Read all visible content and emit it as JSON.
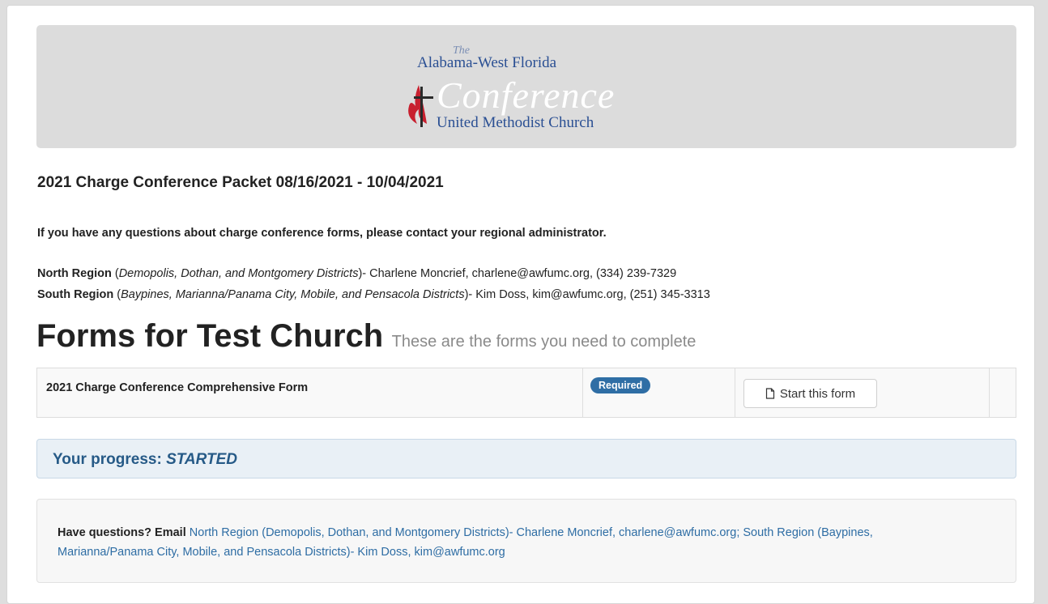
{
  "logo": {
    "the": "The",
    "line1": "Alabama-West Florida",
    "line2": "Conference",
    "line3": "United Methodist Church",
    "colors": {
      "blue": "#2a4f93",
      "red": "#c8202f"
    },
    "icon": "cross-and-flame-icon"
  },
  "packet": {
    "title": "2021 Charge Conference Packet 08/16/2021 - 10/04/2021"
  },
  "notice": "If you have any questions about charge conference forms, please contact your regional administrator.",
  "regions": [
    {
      "name": "North Region",
      "open": " (",
      "districts": "Demopolis, Dothan, and Montgomery Districts",
      "contact": ")- Charlene Moncrief, charlene@awfumc.org, (334) 239-7329"
    },
    {
      "name": "South Region",
      "open": " (",
      "districts": "Baypines, Marianna/Panama City, Mobile, and Pensacola Districts",
      "contact": ")- Kim Doss, kim@awfumc.org, (251) 345-3313"
    }
  ],
  "forms": {
    "heading": "Forms for Test Church",
    "subheading": "These are the forms you need to complete",
    "rows": [
      {
        "name": "2021 Charge Conference Comprehensive Form",
        "badge": "Required",
        "action": "Start this form",
        "action_icon": "document-icon"
      }
    ]
  },
  "progress": {
    "label": "Your progress: ",
    "status": "STARTED"
  },
  "questions": {
    "lead": "Have questions? Email",
    "link": " North Region (Demopolis, Dothan, and Montgomery Districts)- Charlene Moncrief, charlene@awfumc.org; South Region (Baypines, Marianna/Panama City, Mobile, and Pensacola Districts)- Kim Doss, kim@awfumc.org"
  },
  "colors": {
    "accent": "#2f6ea5",
    "link": "#2e6da4",
    "progress_text": "#265a87",
    "progress_bg": "#e9f0f6"
  }
}
